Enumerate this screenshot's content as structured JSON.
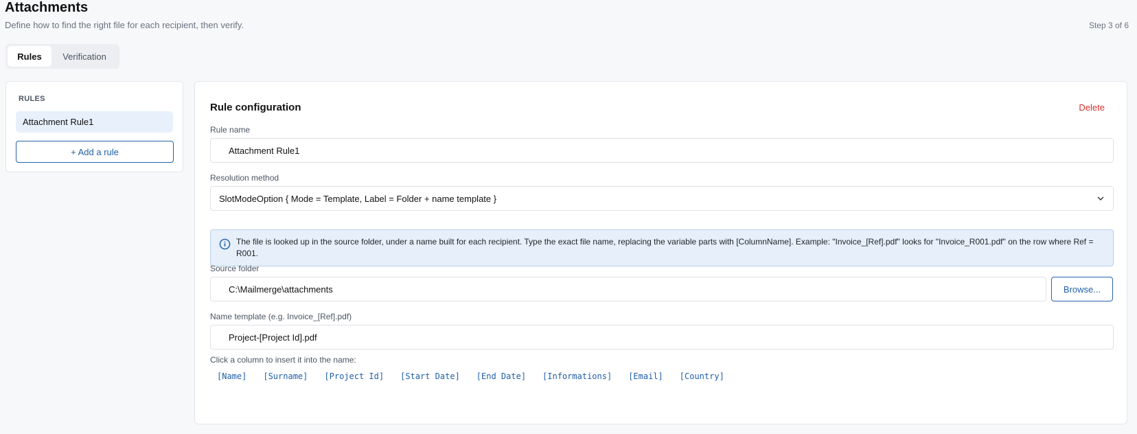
{
  "header": {
    "title": "Attachments",
    "subtitle": "Define how to find the right file for each recipient, then verify.",
    "step": "Step 3 of 6"
  },
  "tabs": [
    {
      "label": "Rules",
      "active": true
    },
    {
      "label": "Verification",
      "active": false
    }
  ],
  "rules_panel": {
    "heading": "RULES",
    "items": [
      {
        "label": "Attachment Rule1",
        "selected": true
      }
    ],
    "add_label": "+ Add a rule"
  },
  "config": {
    "title": "Rule configuration",
    "delete_label": "Delete",
    "rule_name": {
      "label": "Rule name",
      "value": "Attachment Rule1"
    },
    "resolution": {
      "label": "Resolution method",
      "value": "SlotModeOption { Mode = Template, Label = Folder + name template }",
      "icon": "chevron-down-icon"
    },
    "info": {
      "icon": "info-icon",
      "text": "The file is looked up in the source folder, under a name built for each recipient. Type the exact file name, replacing the variable parts with [ColumnName]. Example: \"Invoice_[Ref].pdf\" looks for \"Invoice_R001.pdf\" on the row where Ref = R001."
    },
    "source_folder": {
      "label": "Source folder",
      "value": "C:\\Mailmerge\\attachments",
      "browse_label": "Browse..."
    },
    "name_template": {
      "label": "Name template (e.g. Invoice_[Ref].pdf)",
      "value": "Project-[Project Id].pdf"
    },
    "columns_hint": "Click a column to insert it into the name:",
    "columns": [
      "[Name]",
      "[Surname]",
      "[Project Id]",
      "[Start Date]",
      "[End Date]",
      "[Informations]",
      "[Email]",
      "[Country]"
    ]
  },
  "colors": {
    "accent": "#1f5fa8",
    "danger": "#d0312d",
    "info_bg": "#e6effa",
    "selected_bg": "#e8f0fb"
  }
}
